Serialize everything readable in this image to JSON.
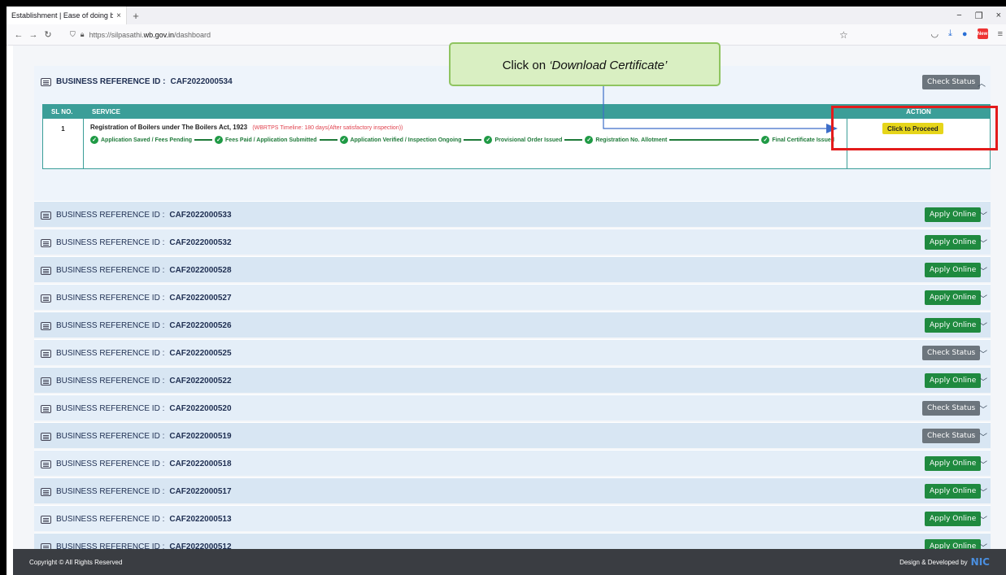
{
  "browser": {
    "tab_title": "Establishment | Ease of doing busin",
    "tab_close": "×",
    "new_tab": "+",
    "url_prefix": "https://silpasathi.",
    "url_domain": "wb.gov.in",
    "url_path": "/dashboard",
    "win_min": "−",
    "win_restore": "❐",
    "win_close": "×"
  },
  "callout": {
    "text_prefix": "Click on ",
    "text_emph": "‘Download Certificate’"
  },
  "open_section": {
    "label": "BUSINESS REFERENCE ID :",
    "id": "CAF2022000534",
    "button": "Check Status",
    "table": {
      "headers": [
        "SL NO.",
        "SERVICE",
        "ACTION"
      ],
      "row": {
        "sl": "1",
        "service": "Registration of Boilers under The Boilers Act, 1923",
        "note": "(WBRTPS Timeline: 180 days(After satisfactory inspection))",
        "steps": [
          "Application Saved / Fees Pending",
          "Fees Paid / Application Submitted",
          "Application Verified / Inspection Ongoing",
          "Provisional Order Issued",
          "Registration No. Allotment",
          "Final Certificate Issued"
        ],
        "action": "Click to Proceed"
      }
    }
  },
  "row_label": "BUSINESS REFERENCE ID :",
  "rows": [
    {
      "id": "CAF2022000533",
      "button": "Apply Online",
      "type": "green"
    },
    {
      "id": "CAF2022000532",
      "button": "Apply Online",
      "type": "green"
    },
    {
      "id": "CAF2022000528",
      "button": "Apply Online",
      "type": "green"
    },
    {
      "id": "CAF2022000527",
      "button": "Apply Online",
      "type": "green"
    },
    {
      "id": "CAF2022000526",
      "button": "Apply Online",
      "type": "green"
    },
    {
      "id": "CAF2022000525",
      "button": "Check Status",
      "type": "gray"
    },
    {
      "id": "CAF2022000522",
      "button": "Apply Online",
      "type": "green"
    },
    {
      "id": "CAF2022000520",
      "button": "Check Status",
      "type": "gray"
    },
    {
      "id": "CAF2022000519",
      "button": "Check Status",
      "type": "gray"
    },
    {
      "id": "CAF2022000518",
      "button": "Apply Online",
      "type": "green"
    },
    {
      "id": "CAF2022000517",
      "button": "Apply Online",
      "type": "green"
    },
    {
      "id": "CAF2022000513",
      "button": "Apply Online",
      "type": "green"
    },
    {
      "id": "CAF2022000512",
      "button": "Apply Online",
      "type": "green"
    }
  ],
  "footer": {
    "copyright": "Copyright © All Rights Reserved",
    "credit": "Design & Developed by",
    "logo": "NIC"
  }
}
